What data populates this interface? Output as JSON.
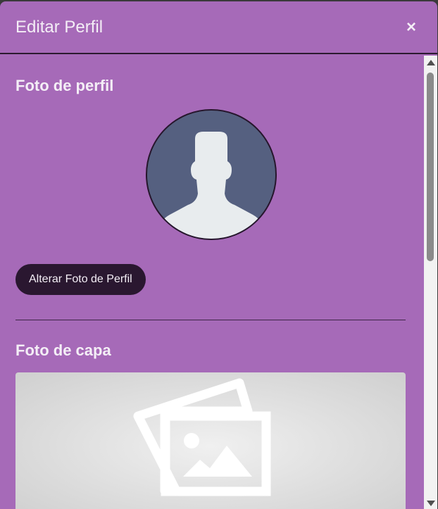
{
  "modal": {
    "title": "Editar Perfil",
    "close_label": "×"
  },
  "profile_photo": {
    "section_title": "Foto de perfil",
    "button_label": "Alterar Foto de Perfil"
  },
  "cover_photo": {
    "section_title": "Foto de capa"
  },
  "colors": {
    "modal_bg": "#a66ab8",
    "button_bg": "#2a1730",
    "avatar_bg": "#556080"
  },
  "icons": {
    "close": "close-icon",
    "avatar": "user-silhouette-icon",
    "cover": "image-placeholder-icon"
  }
}
